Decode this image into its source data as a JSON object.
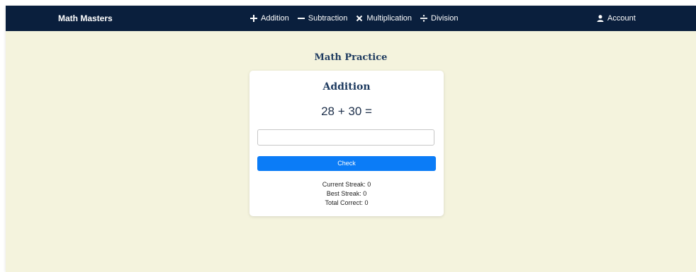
{
  "navbar": {
    "brand": "Math Masters",
    "links": [
      {
        "label": "Addition",
        "icon": "plus-icon"
      },
      {
        "label": "Subtraction",
        "icon": "minus-icon"
      },
      {
        "label": "Multiplication",
        "icon": "times-icon"
      },
      {
        "label": "Division",
        "icon": "divide-icon"
      }
    ],
    "account_label": "Account",
    "account_icon": "user-icon"
  },
  "main": {
    "title": "Math Practice",
    "card": {
      "title": "Addition",
      "problem": "28 + 30 =",
      "answer_value": "",
      "answer_placeholder": "",
      "check_label": "Check",
      "stats": [
        {
          "text": "Current Streak: 0"
        },
        {
          "text": "Best Streak: 0"
        },
        {
          "text": "Total Correct: 0"
        }
      ]
    }
  },
  "colors": {
    "navbar_bg": "#0a1f3d",
    "page_bg": "#f4f3dd",
    "accent": "#0b7cf7",
    "heading": "#1d3a5f"
  }
}
